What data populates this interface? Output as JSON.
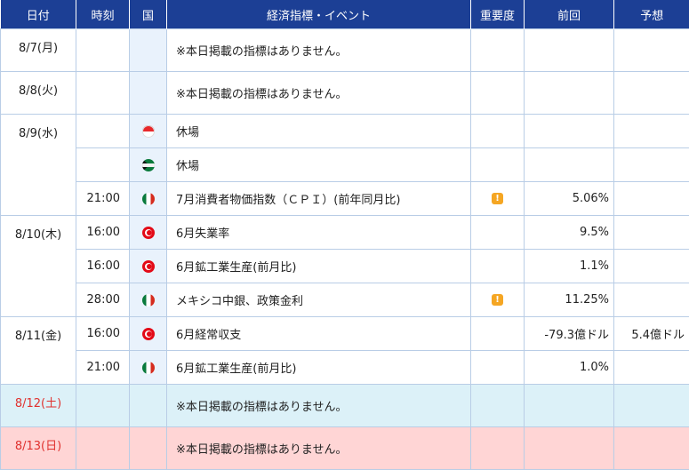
{
  "header": {
    "date": "日付",
    "time": "時刻",
    "country": "国",
    "event": "経済指標・イベント",
    "importance": "重要度",
    "previous": "前回",
    "forecast": "予想"
  },
  "days": [
    {
      "date": "8/7(月)",
      "rows": [
        {
          "event": "※本日掲載の指標はありません。"
        }
      ]
    },
    {
      "date": "8/8(火)",
      "rows": [
        {
          "event": "※本日掲載の指標はありません。"
        }
      ]
    },
    {
      "date": "8/9(水)",
      "rows": [
        {
          "time": "",
          "flag": "singapore-flag-icon",
          "event": "休場"
        },
        {
          "time": "",
          "flag": "south-africa-flag-icon",
          "event": "休場"
        },
        {
          "time": "21:00",
          "flag": "mexico-flag-icon",
          "event": "7月消費者物価指数（ＣＰＩ）(前年同月比)",
          "importance": "!",
          "previous": "5.06%"
        }
      ]
    },
    {
      "date": "8/10(木)",
      "rows": [
        {
          "time": "16:00",
          "flag": "turkey-flag-icon",
          "event": "6月失業率",
          "previous": "9.5%"
        },
        {
          "time": "16:00",
          "flag": "turkey-flag-icon",
          "event": "6月鉱工業生産(前月比)",
          "previous": "1.1%"
        },
        {
          "time": "28:00",
          "flag": "mexico-flag-icon",
          "event": "メキシコ中銀、政策金利",
          "importance": "!",
          "previous": "11.25%"
        }
      ]
    },
    {
      "date": "8/11(金)",
      "rows": [
        {
          "time": "16:00",
          "flag": "turkey-flag-icon",
          "event": "6月経常収支",
          "previous": "-79.3億ドル",
          "forecast": "5.4億ドル"
        },
        {
          "time": "21:00",
          "flag": "mexico-flag-icon",
          "event": "6月鉱工業生産(前月比)",
          "previous": "1.0%"
        }
      ]
    },
    {
      "date": "8/12(土)",
      "rows": [
        {
          "event": "※本日掲載の指標はありません。"
        }
      ]
    },
    {
      "date": "8/13(日)",
      "rows": [
        {
          "event": "※本日掲載の指標はありません。"
        }
      ]
    }
  ],
  "colors": {
    "header_bg": "#1c3f95",
    "saturday_bg": "#dcf1f8",
    "sunday_bg": "#ffd5d5",
    "weekend_date_text": "#e0312e",
    "importance_icon": "#f5a623"
  }
}
